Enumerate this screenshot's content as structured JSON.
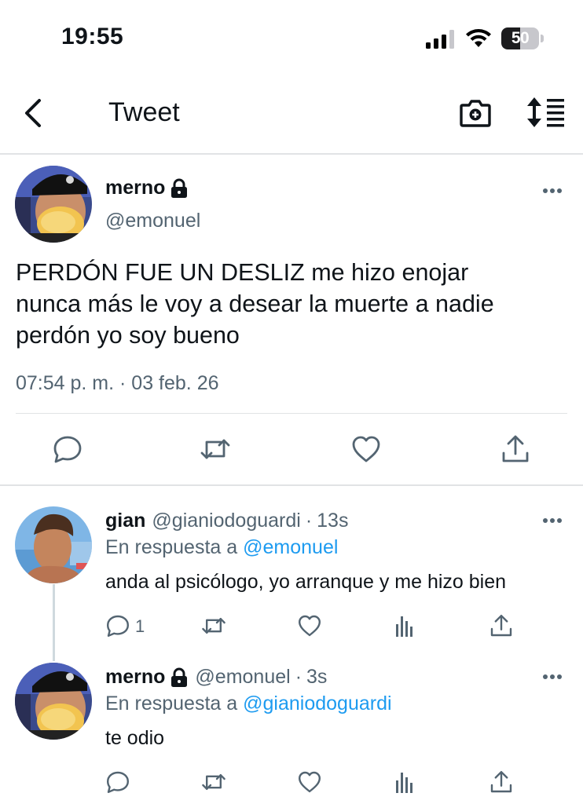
{
  "status_bar": {
    "time": "19:55",
    "battery_level": "50",
    "battery_percent": 50,
    "icons": [
      "signal-icon",
      "wifi-icon",
      "battery-icon"
    ]
  },
  "nav": {
    "title": "Tweet",
    "icons": [
      "back-icon",
      "camera-icon",
      "sort-icon"
    ]
  },
  "main_tweet": {
    "display_name": "merno",
    "handle": "@emonuel",
    "text": "PERDÓN FUE UN DESLIZ me hizo enojar\nnunca más le voy a desear la muerte a nadie\nperdón yo soy bueno",
    "timestamp": "07:54 p. m. · 03 feb. 26",
    "protected": true,
    "actions": [
      "reply-icon",
      "retweet-icon",
      "like-icon",
      "share-icon"
    ]
  },
  "replies": [
    {
      "display_name": "gian",
      "handle": "@gianiodoguardi",
      "separator": "·",
      "time": "13s",
      "context_prefix": "En respuesta a",
      "context_mention": "@emonuel",
      "text": "anda al psicólogo, yo arranque y me hizo bien",
      "reply_count": "1",
      "protected": false
    },
    {
      "display_name": "merno",
      "handle": "@emonuel",
      "separator": "·",
      "time": "3s",
      "context_prefix": "En respuesta a",
      "context_mention": "@gianiodoguardi",
      "text": "te odio",
      "reply_count": "",
      "protected": true
    }
  ],
  "colors": {
    "text_primary": "#0f1419",
    "text_secondary": "#536471",
    "accent": "#1d9bf0",
    "divider": "#e1e3e5"
  }
}
